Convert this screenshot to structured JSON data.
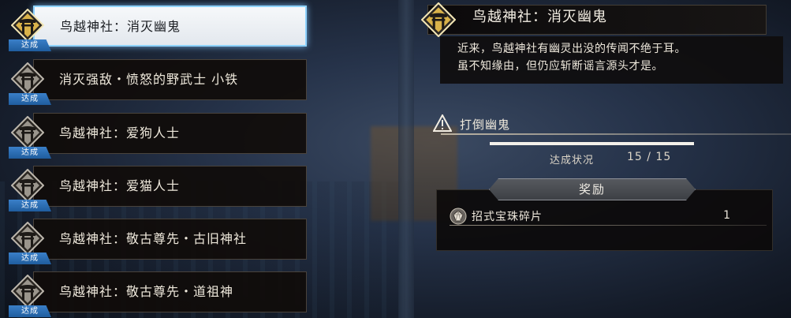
{
  "quests": [
    {
      "title": "鸟越神社：消灭幽鬼",
      "badge": "达成",
      "selected": true
    },
    {
      "title": "消灭强敌・愤怒的野武士 小铁",
      "badge": "达成",
      "selected": false
    },
    {
      "title": "鸟越神社：爱狗人士",
      "badge": "达成",
      "selected": false
    },
    {
      "title": "鸟越神社：爱猫人士",
      "badge": "达成",
      "selected": false
    },
    {
      "title": "鸟越神社：敬古尊先・古旧神社",
      "badge": "达成",
      "selected": false
    },
    {
      "title": "鸟越神社：敬古尊先・道祖神",
      "badge": "达成",
      "selected": false
    }
  ],
  "detail": {
    "title": "鸟越神社：消灭幽鬼",
    "description": "近来，鸟越神社有幽灵出没的传闻不绝于耳。\n虽不知缘由，但仍应斩断谣言源头才是。",
    "objective": "打倒幽鬼",
    "progress_label": "达成状况",
    "progress_value": "15 / 15",
    "progress_fraction": 1.0,
    "reward_tab": "奖励",
    "rewards": [
      {
        "name": "招式宝珠碎片",
        "qty": "1",
        "icon": "gem-icon"
      }
    ]
  },
  "colors": {
    "badge_blue": "#2a6fb4",
    "selected_glow": "#8fd3ff"
  }
}
